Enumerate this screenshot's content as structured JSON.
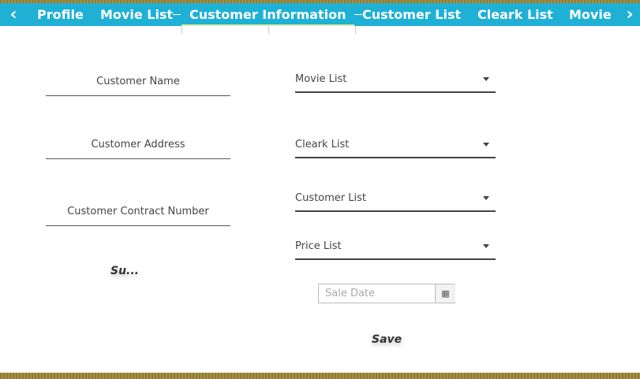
{
  "nav": {
    "left_arrow_icon": "chevron-left-icon",
    "right_arrow_icon": "chevron-right-icon",
    "tabs": [
      {
        "label": "Profile"
      },
      {
        "label": "Movie List"
      },
      {
        "label": "Customer Information"
      },
      {
        "label": "Customer List"
      },
      {
        "label": "Cleark List"
      },
      {
        "label": "Movie"
      }
    ],
    "active_tab": "Customer Information",
    "accent_color": "#1fb0d6"
  },
  "form": {
    "customer_name_label": "Customer Name",
    "customer_address_label": "Customer Address",
    "customer_contract_label": "Customer Contract Number",
    "submit_label": "Su...",
    "movie_list_select": "Movie List",
    "cleark_list_select": "Cleark List",
    "customer_list_select": "Customer List",
    "price_list_select": "Price List",
    "sale_date_placeholder": "Sale Date",
    "calendar_icon": "calendar-icon",
    "save_label": "Save"
  }
}
